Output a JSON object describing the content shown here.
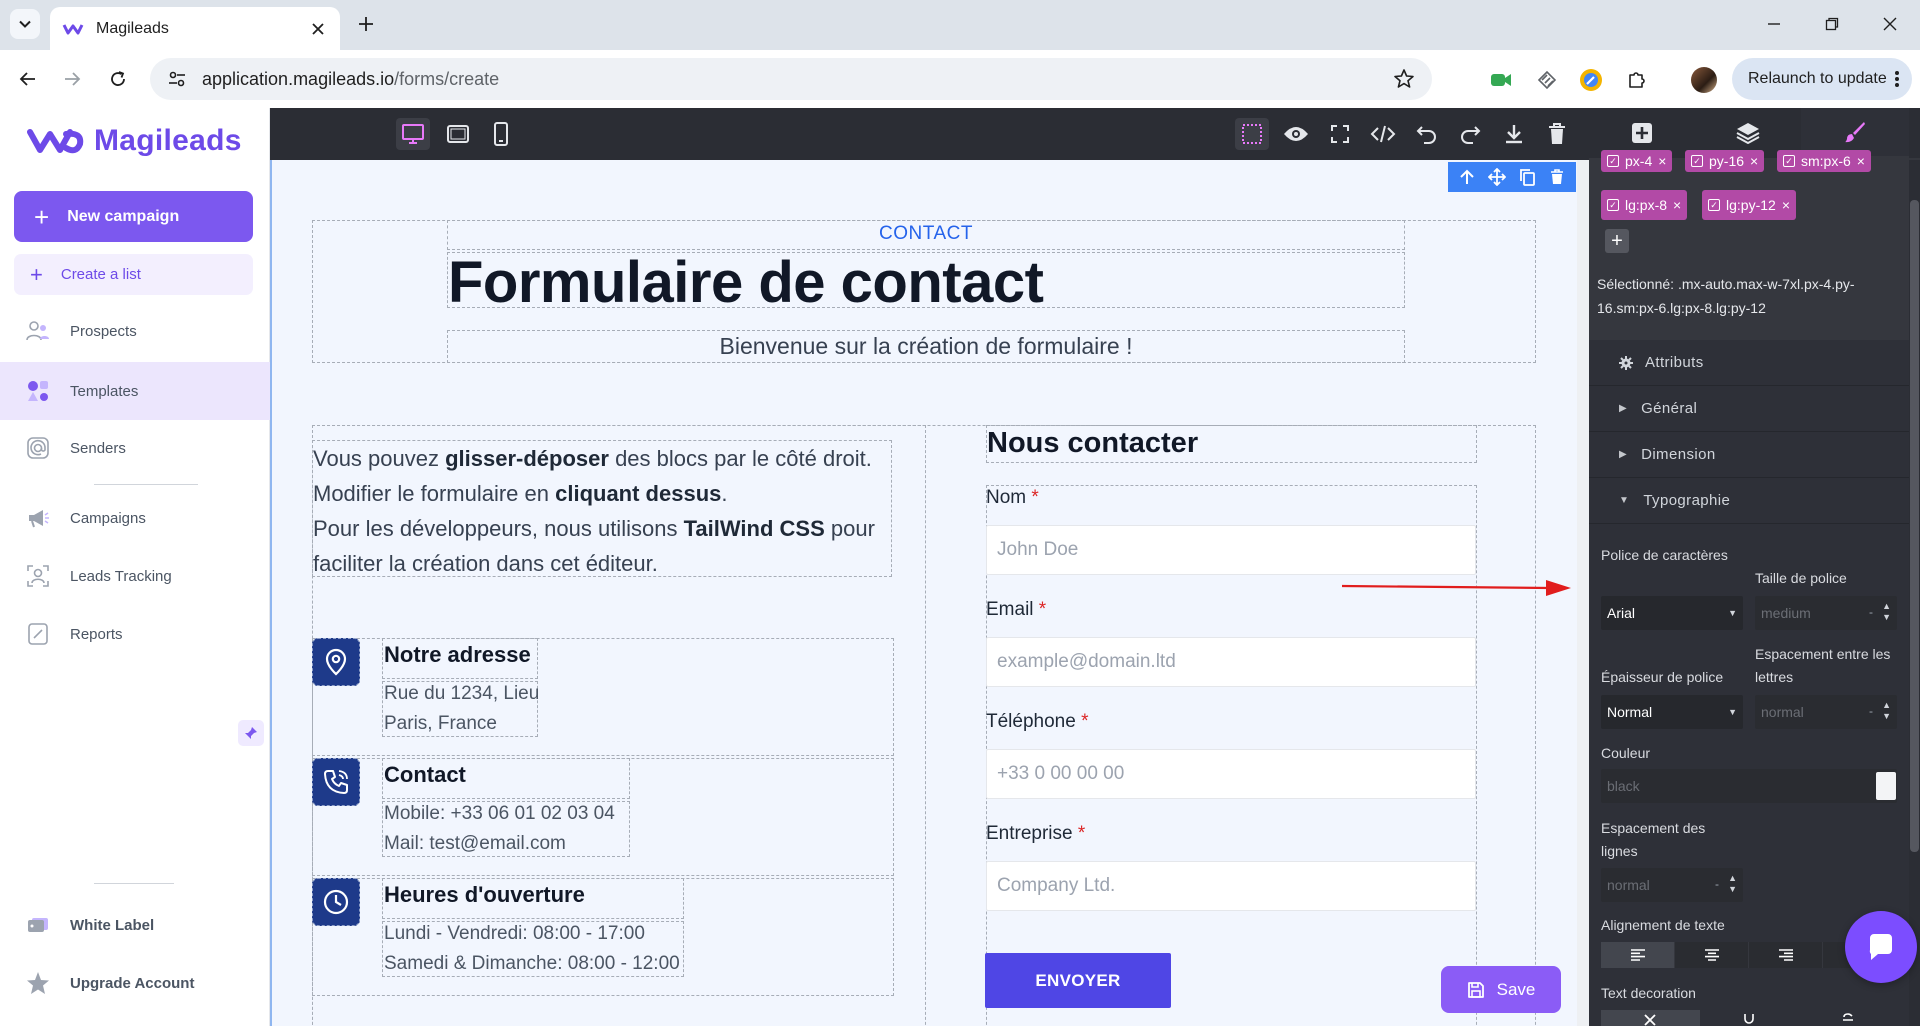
{
  "browser": {
    "tab_title": "Magileads",
    "url_domain": "application.magileads.io",
    "url_path": "/forms/create",
    "relaunch_label": "Relaunch to update"
  },
  "sidebar": {
    "logo_text": "Magileads",
    "new_campaign_label": "New campaign",
    "create_list_label": "Create a list",
    "items": [
      {
        "label": "Prospects",
        "icon": "users-icon"
      },
      {
        "label": "Templates",
        "icon": "templates-icon",
        "active": true
      },
      {
        "label": "Senders",
        "icon": "at-icon"
      },
      {
        "label": "Campaigns",
        "icon": "megaphone-icon"
      },
      {
        "label": "Leads Tracking",
        "icon": "user-frame-icon"
      },
      {
        "label": "Reports",
        "icon": "report-icon"
      }
    ],
    "bottom_items": [
      {
        "label": "White Label",
        "icon": "tag-icon"
      },
      {
        "label": "Upgrade Account",
        "icon": "star-icon"
      }
    ]
  },
  "canvas": {
    "eyebrow": "CONTACT",
    "heading": "Formulaire de contact",
    "subtitle": "Bienvenue sur la création de formulaire !",
    "intro": {
      "p1_a": "Vous pouvez ",
      "p1_b": "glisser-déposer",
      "p1_c": " des blocs par le côté droit.",
      "p2_a": "Modifier le formulaire en ",
      "p2_b": "cliquant dessus",
      "p2_c": ".",
      "p3_a": "Pour les développeurs, nous utilisons ",
      "p3_b": "TailWind CSS",
      "p3_c": " pour",
      "p4": "faciliter la création dans cet éditeur."
    },
    "info": [
      {
        "title": "Notre adresse",
        "lines": [
          "Rue du 1234, Lieu",
          "Paris, France"
        ],
        "icon": "map-pin-icon"
      },
      {
        "title": "Contact",
        "lines": [
          "Mobile: +33 06 01 02 03 04",
          "Mail: test@email.com"
        ],
        "icon": "phone-icon"
      },
      {
        "title": "Heures d'ouverture",
        "lines": [
          "Lundi - Vendredi: 08:00 - 17:00",
          "Samedi & Dimanche: 08:00 - 12:00"
        ],
        "icon": "clock-icon"
      }
    ],
    "form": {
      "title": "Nous contacter",
      "fields": [
        {
          "label": "Nom",
          "placeholder": "John Doe"
        },
        {
          "label": "Email",
          "placeholder": "example@domain.ltd"
        },
        {
          "label": "Téléphone",
          "placeholder": "+33 0 00 00 00"
        },
        {
          "label": "Entreprise",
          "placeholder": "Company Ltd."
        }
      ],
      "required_mark": "*",
      "submit_label": "ENVOYER"
    },
    "save_label": "Save"
  },
  "panel": {
    "classes": [
      "px-4",
      "py-16",
      "sm:px-6",
      "lg:px-8",
      "lg:py-12"
    ],
    "selected_label": "Sélectionné: .mx-auto.max-w-7xl.px-4.py-16.sm:px-6.lg:px-8.lg:py-12",
    "sectors": [
      "Attributs",
      "Général",
      "Dimension",
      "Typographie"
    ],
    "typography": {
      "font_family_label": "Police de caractères",
      "font_family_value": "Arial",
      "font_size_label": "Taille de police",
      "font_size_placeholder": "medium",
      "font_weight_label": "Épaisseur de police",
      "font_weight_value": "Normal",
      "letter_spacing_label": "Espacement entre les lettres",
      "letter_spacing_placeholder": "normal",
      "color_label": "Couleur",
      "color_placeholder": "black",
      "line_height_label": "Espacement des lignes",
      "line_height_placeholder": "normal",
      "text_align_label": "Alignement de texte",
      "text_decoration_label": "Text decoration",
      "unit": "-"
    }
  },
  "colors": {
    "brand": "#6d4ae8",
    "primary_button": "#7c58ef",
    "submit": "#4f46e5",
    "tag": "#b24aa6",
    "editor_dark": "#2b2d34"
  }
}
